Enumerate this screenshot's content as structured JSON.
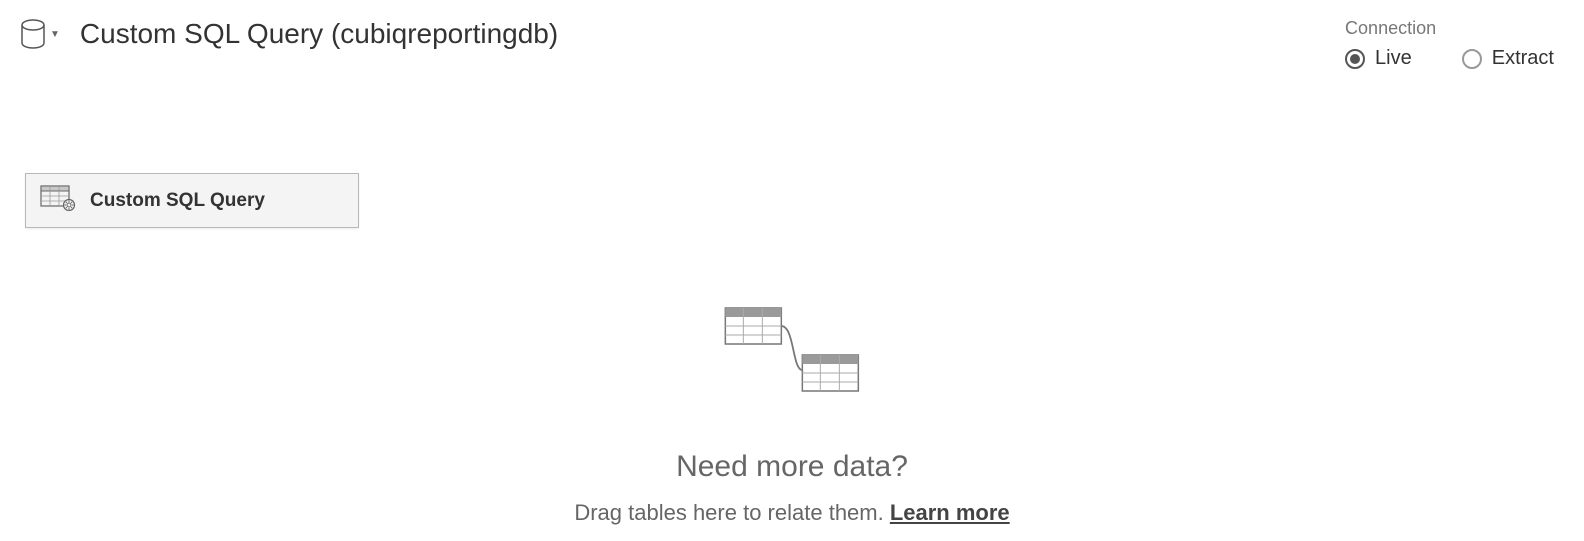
{
  "header": {
    "title": "Custom SQL Query (cubiqreportingdb)"
  },
  "connection": {
    "label": "Connection",
    "options": {
      "live": "Live",
      "extract": "Extract"
    },
    "selected": "live"
  },
  "table_node": {
    "label": "Custom SQL Query"
  },
  "empty_state": {
    "heading": "Need more data?",
    "subtext": "Drag tables here to relate them. ",
    "learn_more": "Learn more"
  }
}
